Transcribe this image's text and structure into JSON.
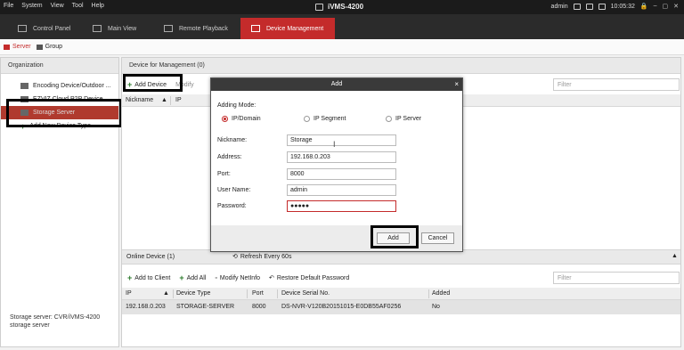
{
  "titlebar": {
    "menu": [
      "File",
      "System",
      "View",
      "Tool",
      "Help"
    ],
    "app_title": "iVMS-4200",
    "user": "admin",
    "time": "10:05:32",
    "window_controls": [
      "🔒",
      "–",
      "▢",
      "✕"
    ]
  },
  "tabs": [
    {
      "label": "Control Panel",
      "icon": "grid-icon"
    },
    {
      "label": "Main View",
      "icon": "monitor-icon"
    },
    {
      "label": "Remote Playback",
      "icon": "playback-icon"
    },
    {
      "label": "Device Management",
      "icon": "device-icon"
    }
  ],
  "subbar": {
    "server": "Server",
    "group": "Group"
  },
  "left": {
    "header": "Organization",
    "items": [
      "Encoding Device/Outdoor ...",
      "EZVIZ Cloud P2P Device",
      "Storage Server",
      "Add New Device Type"
    ],
    "footer_line1": "Storage server: CVR/iVMS-4200",
    "footer_line2": "storage server"
  },
  "main": {
    "section_title": "Device for Management (0)",
    "add_device": "Add Device",
    "modify": "Modify",
    "filter_placeholder": "Filter",
    "col_nickname": "Nickname",
    "col_ip": "IP"
  },
  "online": {
    "title": "Online Device (1)",
    "refresh": "Refresh Every 60s",
    "add_to_client": "Add to Client",
    "add_all": "Add All",
    "modify_netinfo": "Modify NetInfo",
    "restore": "Restore Default Password",
    "filter_placeholder": "Filter",
    "headers": [
      "IP",
      "Device Type",
      "Port",
      "Device Serial No.",
      "Added"
    ],
    "row": {
      "ip": "192.168.0.203",
      "type": "STORAGE-SERVER",
      "port": "8000",
      "serial": "DS-NVR-V120B20151015-E0DB55AF0256",
      "added": "No"
    }
  },
  "dialog": {
    "title": "Add",
    "close": "×",
    "adding_mode_label": "Adding Mode:",
    "modes": [
      "IP/Domain",
      "IP Segment",
      "IP Server"
    ],
    "fields": {
      "nickname_label": "Nickname:",
      "nickname": "Storage",
      "address_label": "Address:",
      "address": "192.168.0.203",
      "port_label": "Port:",
      "port": "8000",
      "username_label": "User Name:",
      "username": "admin",
      "password_label": "Password:",
      "password": "●●●●●"
    },
    "add_button": "Add",
    "cancel_button": "Cancel"
  }
}
